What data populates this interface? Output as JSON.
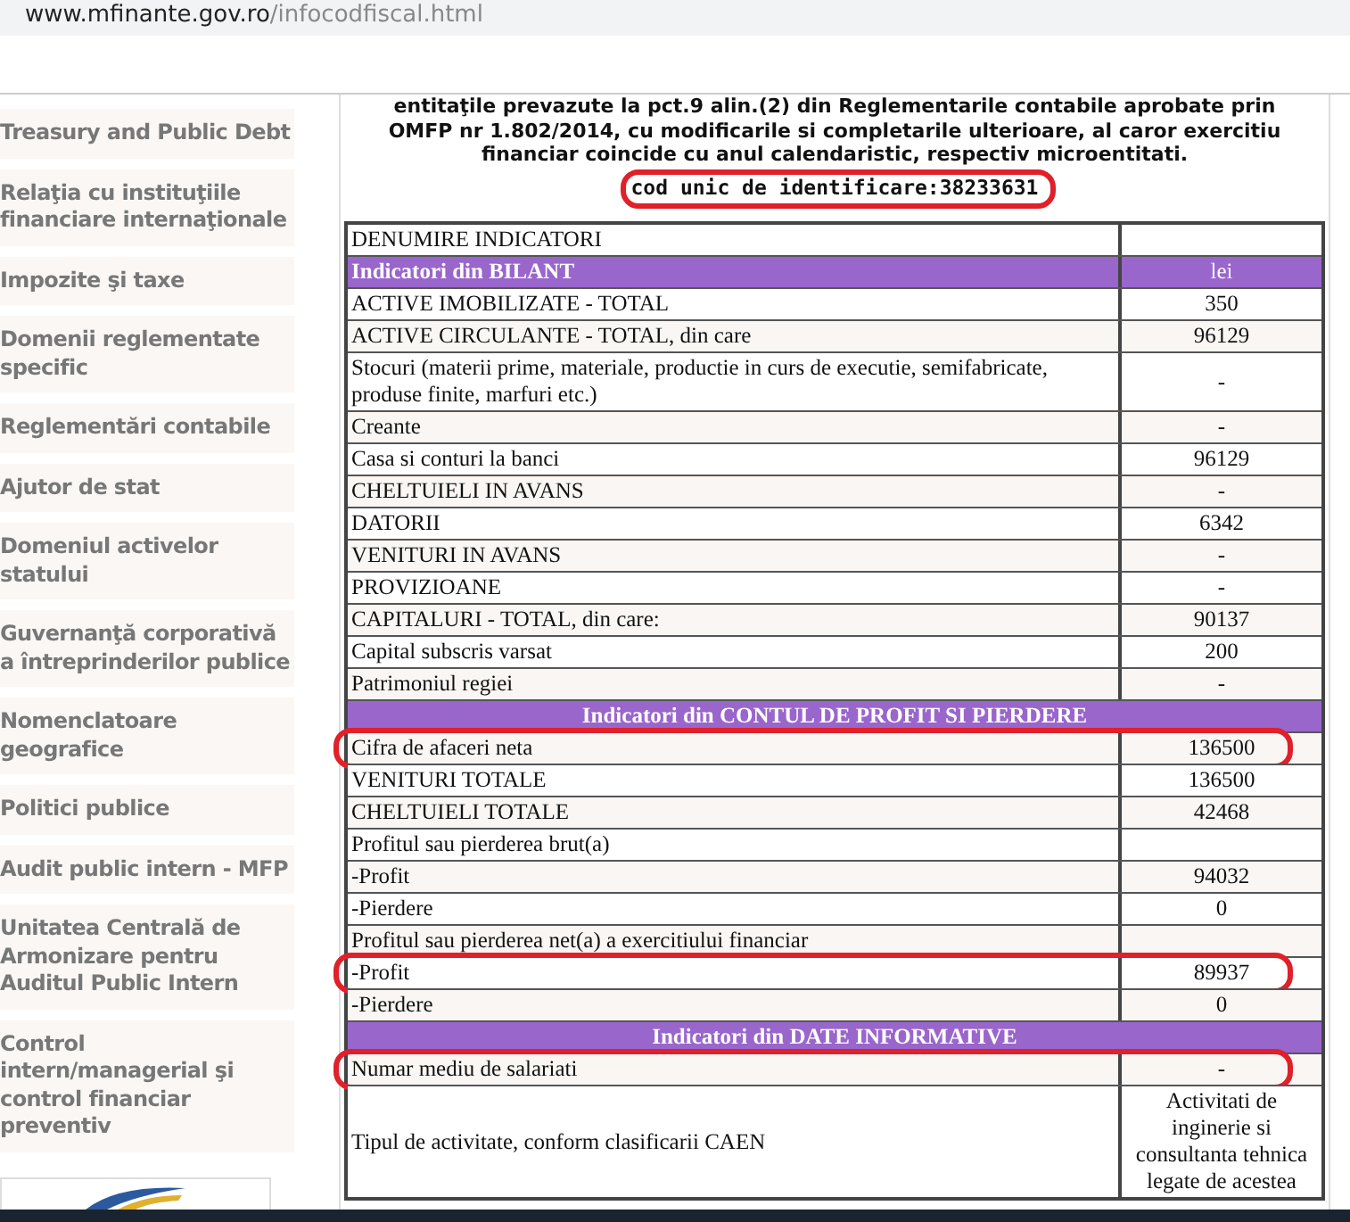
{
  "address_bar": {
    "domain": "www.mfinante.gov.ro",
    "path": "/infocodfiscal.html"
  },
  "sidebar": {
    "items": [
      {
        "label": "Treasury and Public Debt"
      },
      {
        "label": "Relaţia cu instituţiile financiare internaţionale"
      },
      {
        "label": "Impozite şi taxe"
      },
      {
        "label": "Domenii reglementate specific"
      },
      {
        "label": "Reglementări contabile"
      },
      {
        "label": "Ajutor de stat"
      },
      {
        "label": "Domeniul activelor statului"
      },
      {
        "label": "Guvernanţă corporativă a întreprinderilor publice"
      },
      {
        "label": "Nomenclatoare geografice"
      },
      {
        "label": "Politici publice"
      },
      {
        "label": "Audit public intern - MFP"
      },
      {
        "label": "Unitatea Centrală de Armonizare pentru Auditul Public Intern"
      },
      {
        "label": "Control intern/managerial şi control financiar preventiv"
      }
    ]
  },
  "intro": {
    "text": "entitaţile prevazute la pct.9 alin.(2) din Reglementarile contabile aprobate prin OMFP nr 1.802/2014, cu modificarile si completarile ulterioare, al caror exercitiu financiar coincide cu anul calendaristic, respectiv microentitati.",
    "code": "cod unic de identificare:38233631",
    "highlighted": true
  },
  "table": {
    "rows": [
      {
        "kind": "plain",
        "label": "DENUMIRE INDICATORI",
        "highlighted": false
      },
      {
        "kind": "header",
        "label": "Indicatori din BILANT",
        "value": "lei",
        "highlighted": false
      },
      {
        "kind": "plain",
        "label": "ACTIVE IMOBILIZATE - TOTAL",
        "value": "350",
        "highlighted": false
      },
      {
        "kind": "plain",
        "label": "ACTIVE CIRCULANTE - TOTAL, din care",
        "value": "96129",
        "highlighted": false
      },
      {
        "kind": "plain",
        "label": "Stocuri (materii prime, materiale, productie in curs de executie, semifabricate, produse finite, marfuri etc.)",
        "value": "-",
        "highlighted": false
      },
      {
        "kind": "plain",
        "label": "Creante",
        "value": "-",
        "highlighted": false
      },
      {
        "kind": "plain",
        "label": "Casa si conturi la banci",
        "value": "96129",
        "highlighted": false
      },
      {
        "kind": "plain",
        "label": "CHELTUIELI IN AVANS",
        "value": "-",
        "highlighted": false
      },
      {
        "kind": "plain",
        "label": "DATORII",
        "value": "6342",
        "highlighted": false
      },
      {
        "kind": "plain",
        "label": "VENITURI IN AVANS",
        "value": "-",
        "highlighted": false
      },
      {
        "kind": "plain",
        "label": "PROVIZIOANE",
        "value": "-",
        "highlighted": false
      },
      {
        "kind": "plain",
        "label": "CAPITALURI - TOTAL, din care:",
        "value": "90137",
        "highlighted": false
      },
      {
        "kind": "plain",
        "label": "Capital subscris varsat",
        "value": "200",
        "highlighted": false
      },
      {
        "kind": "plain",
        "label": "Patrimoniul regiei",
        "value": "-",
        "highlighted": false
      },
      {
        "kind": "section",
        "label": "Indicatori din CONTUL DE PROFIT SI PIERDERE",
        "highlighted": false
      },
      {
        "kind": "plain",
        "label": "Cifra de afaceri neta",
        "value": "136500",
        "highlighted": true
      },
      {
        "kind": "plain",
        "label": "VENITURI TOTALE",
        "value": "136500",
        "highlighted": false
      },
      {
        "kind": "plain",
        "label": "CHELTUIELI TOTALE",
        "value": "42468",
        "highlighted": false
      },
      {
        "kind": "plain",
        "label": "Profitul sau pierderea brut(a)",
        "highlighted": false
      },
      {
        "kind": "plain",
        "label": "-Profit",
        "value": "94032",
        "highlighted": false
      },
      {
        "kind": "plain",
        "label": "-Pierdere",
        "value": "0",
        "highlighted": false
      },
      {
        "kind": "plain",
        "label": "Profitul sau pierderea net(a) a exercitiului financiar",
        "highlighted": false
      },
      {
        "kind": "plain",
        "label": "-Profit",
        "value": "89937",
        "highlighted": true
      },
      {
        "kind": "plain",
        "label": "-Pierdere",
        "value": "0",
        "highlighted": false
      },
      {
        "kind": "section",
        "label": "Indicatori din DATE INFORMATIVE",
        "highlighted": false
      },
      {
        "kind": "plain",
        "label": "Numar mediu de salariati",
        "value": "-",
        "highlighted": true
      },
      {
        "kind": "plain",
        "label": "Tipul de activitate, conform clasificarii CAEN",
        "value": "Activitati de inginerie si consultanta tehnica legate de acestea",
        "highlighted": false
      }
    ]
  }
}
